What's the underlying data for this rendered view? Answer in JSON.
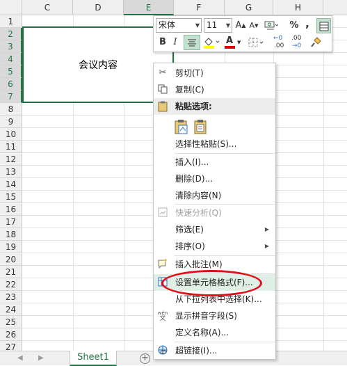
{
  "columns": [
    "C",
    "D",
    "E",
    "F",
    "G",
    "H"
  ],
  "rows": [
    "1",
    "2",
    "3",
    "4",
    "5",
    "6",
    "7",
    "8",
    "9",
    "10",
    "11",
    "12",
    "13",
    "14",
    "15",
    "16",
    "17",
    "18",
    "19",
    "20",
    "21",
    "22",
    "23",
    "24",
    "25",
    "26",
    "27"
  ],
  "merged_cell": {
    "text": "会议内容"
  },
  "sheet_tab": "Sheet1",
  "add_sheet_symbol": "+",
  "mini_toolbar": {
    "font_name": "宋体",
    "font_size": "11",
    "grow_font": "A",
    "shrink_font": "A",
    "percent": "%",
    "comma": ",",
    "bold": "B",
    "italic": "I",
    "font_color_letter": "A",
    "decimal_increase": ".00",
    "decimal_decrease": ".00",
    "accent_colors": {
      "highlight": "#ffff00",
      "font_color": "#e00000"
    }
  },
  "context_menu": {
    "cut": "剪切(T)",
    "copy": "复制(C)",
    "paste_options": "粘贴选项:",
    "paste_special": "选择性粘贴(S)...",
    "insert": "插入(I)...",
    "delete": "删除(D)...",
    "clear_contents": "清除内容(N)",
    "quick_analysis": "快速分析(Q)",
    "filter": "筛选(E)",
    "sort": "排序(O)",
    "insert_comment": "插入批注(M)",
    "format_cells": "设置单元格格式(F)...",
    "pick_from_list": "从下拉列表中选择(K)...",
    "phonetic": "显示拼音字段(S)",
    "define_name": "定义名称(A)...",
    "hyperlink": "超链接(I)...",
    "phonetic_icon_text": "wén",
    "phonetic_icon_char": "文"
  },
  "colors": {
    "excel_green": "#217346",
    "annotation_red": "#e0101a"
  }
}
